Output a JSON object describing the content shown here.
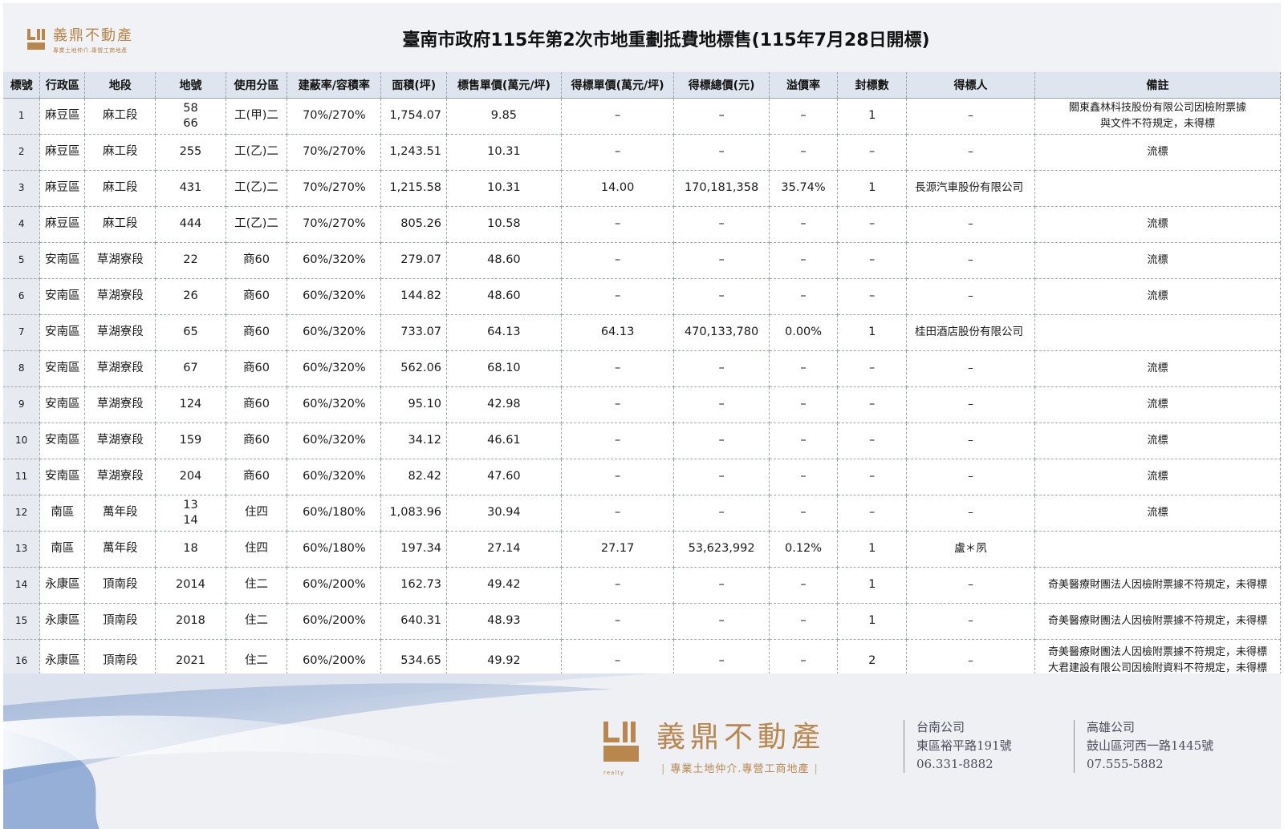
{
  "header": {
    "logo_name": "義鼎不動產",
    "logo_slogan": "專業土地仲介.專營工商地產",
    "title": "臺南市政府115年第2次市地重劃抵費地標售(115年7月28日開標)"
  },
  "table": {
    "columns": [
      "標號",
      "行政區",
      "地段",
      "地號",
      "使用分區",
      "建蔽率/容積率",
      "面積(坪)",
      "標售單價(萬元/坪)",
      "得標單價(萬元/坪)",
      "得標總價(元)",
      "溢價率",
      "封標數",
      "得標人",
      "備註"
    ],
    "rows": [
      {
        "no": "1",
        "district": "麻豆區",
        "section": "麻工段",
        "lot": [
          "58",
          "66"
        ],
        "zone": "工(甲)二",
        "ratio": "70%/270%",
        "area": "1,754.07",
        "price": "9.85",
        "win_price": "–",
        "win_total": "–",
        "premium": "–",
        "bids": "1",
        "winner": "–",
        "note": [
          "關東鑫林科技股份有限公司因檢附票據",
          "與文件不符規定，未得標"
        ]
      },
      {
        "no": "2",
        "district": "麻豆區",
        "section": "麻工段",
        "lot": [
          "255"
        ],
        "zone": "工(乙)二",
        "ratio": "70%/270%",
        "area": "1,243.51",
        "price": "10.31",
        "win_price": "–",
        "win_total": "–",
        "premium": "–",
        "bids": "–",
        "winner": "–",
        "note": [
          "流標"
        ]
      },
      {
        "no": "3",
        "district": "麻豆區",
        "section": "麻工段",
        "lot": [
          "431"
        ],
        "zone": "工(乙)二",
        "ratio": "70%/270%",
        "area": "1,215.58",
        "price": "10.31",
        "win_price": "14.00",
        "win_total": "170,181,358",
        "premium": "35.74%",
        "bids": "1",
        "winner": "長源汽車股份有限公司",
        "note": [
          ""
        ]
      },
      {
        "no": "4",
        "district": "麻豆區",
        "section": "麻工段",
        "lot": [
          "444"
        ],
        "zone": "工(乙)二",
        "ratio": "70%/270%",
        "area": "805.26",
        "price": "10.58",
        "win_price": "–",
        "win_total": "–",
        "premium": "–",
        "bids": "–",
        "winner": "–",
        "note": [
          "流標"
        ]
      },
      {
        "no": "5",
        "district": "安南區",
        "section": "草湖寮段",
        "lot": [
          "22"
        ],
        "zone": "商60",
        "ratio": "60%/320%",
        "area": "279.07",
        "price": "48.60",
        "win_price": "–",
        "win_total": "–",
        "premium": "–",
        "bids": "–",
        "winner": "–",
        "note": [
          "流標"
        ]
      },
      {
        "no": "6",
        "district": "安南區",
        "section": "草湖寮段",
        "lot": [
          "26"
        ],
        "zone": "商60",
        "ratio": "60%/320%",
        "area": "144.82",
        "price": "48.60",
        "win_price": "–",
        "win_total": "–",
        "premium": "–",
        "bids": "–",
        "winner": "–",
        "note": [
          "流標"
        ]
      },
      {
        "no": "7",
        "district": "安南區",
        "section": "草湖寮段",
        "lot": [
          "65"
        ],
        "zone": "商60",
        "ratio": "60%/320%",
        "area": "733.07",
        "price": "64.13",
        "win_price": "64.13",
        "win_total": "470,133,780",
        "premium": "0.00%",
        "bids": "1",
        "winner": "桂田酒店股份有限公司",
        "note": [
          ""
        ]
      },
      {
        "no": "8",
        "district": "安南區",
        "section": "草湖寮段",
        "lot": [
          "67"
        ],
        "zone": "商60",
        "ratio": "60%/320%",
        "area": "562.06",
        "price": "68.10",
        "win_price": "–",
        "win_total": "–",
        "premium": "–",
        "bids": "–",
        "winner": "–",
        "note": [
          "流標"
        ]
      },
      {
        "no": "9",
        "district": "安南區",
        "section": "草湖寮段",
        "lot": [
          "124"
        ],
        "zone": "商60",
        "ratio": "60%/320%",
        "area": "95.10",
        "price": "42.98",
        "win_price": "–",
        "win_total": "–",
        "premium": "–",
        "bids": "–",
        "winner": "–",
        "note": [
          "流標"
        ]
      },
      {
        "no": "10",
        "district": "安南區",
        "section": "草湖寮段",
        "lot": [
          "159"
        ],
        "zone": "商60",
        "ratio": "60%/320%",
        "area": "34.12",
        "price": "46.61",
        "win_price": "–",
        "win_total": "–",
        "premium": "–",
        "bids": "–",
        "winner": "–",
        "note": [
          "流標"
        ]
      },
      {
        "no": "11",
        "district": "安南區",
        "section": "草湖寮段",
        "lot": [
          "204"
        ],
        "zone": "商60",
        "ratio": "60%/320%",
        "area": "82.42",
        "price": "47.60",
        "win_price": "–",
        "win_total": "–",
        "premium": "–",
        "bids": "–",
        "winner": "–",
        "note": [
          "流標"
        ]
      },
      {
        "no": "12",
        "district": "南區",
        "section": "萬年段",
        "lot": [
          "13",
          "14"
        ],
        "zone": "住四",
        "ratio": "60%/180%",
        "area": "1,083.96",
        "price": "30.94",
        "win_price": "–",
        "win_total": "–",
        "premium": "–",
        "bids": "–",
        "winner": "–",
        "note": [
          "流標"
        ]
      },
      {
        "no": "13",
        "district": "南區",
        "section": "萬年段",
        "lot": [
          "18"
        ],
        "zone": "住四",
        "ratio": "60%/180%",
        "area": "197.34",
        "price": "27.14",
        "win_price": "27.17",
        "win_total": "53,623,992",
        "premium": "0.12%",
        "bids": "1",
        "winner": "盧＊夙",
        "note": [
          ""
        ]
      },
      {
        "no": "14",
        "district": "永康區",
        "section": "頂南段",
        "lot": [
          "2014"
        ],
        "zone": "住二",
        "ratio": "60%/200%",
        "area": "162.73",
        "price": "49.42",
        "win_price": "–",
        "win_total": "–",
        "premium": "–",
        "bids": "1",
        "winner": "–",
        "note": [
          "奇美醫療財團法人因檢附票據不符規定，未得標"
        ]
      },
      {
        "no": "15",
        "district": "永康區",
        "section": "頂南段",
        "lot": [
          "2018"
        ],
        "zone": "住二",
        "ratio": "60%/200%",
        "area": "640.31",
        "price": "48.93",
        "win_price": "–",
        "win_total": "–",
        "premium": "–",
        "bids": "1",
        "winner": "–",
        "note": [
          "奇美醫療財團法人因檢附票據不符規定，未得標"
        ]
      },
      {
        "no": "16",
        "district": "永康區",
        "section": "頂南段",
        "lot": [
          "2021"
        ],
        "zone": "住二",
        "ratio": "60%/200%",
        "area": "534.65",
        "price": "49.92",
        "win_price": "–",
        "win_total": "–",
        "premium": "–",
        "bids": "2",
        "winner": "–",
        "note": [
          "奇美醫療財團法人因檢附票據不符規定，未得標",
          "大君建設有限公司因檢附資料不符規定，未得標"
        ]
      }
    ]
  },
  "footer": {
    "brand_name": "義鼎不動產",
    "brand_slogan": "專業土地仲介.專營工商地產",
    "brand_tiny": "realty",
    "tainan": {
      "name": "台南公司",
      "address": "東區裕平路191號",
      "phone": "06.331-8882"
    },
    "kaohsiung": {
      "name": "高雄公司",
      "address": "鼓山區河西一路1445號",
      "phone": "07.555-5882"
    }
  },
  "colors": {
    "brand_gold": "#b8874e",
    "header_bg": "#dfe5ee",
    "page_bg": "#eef0f4"
  }
}
